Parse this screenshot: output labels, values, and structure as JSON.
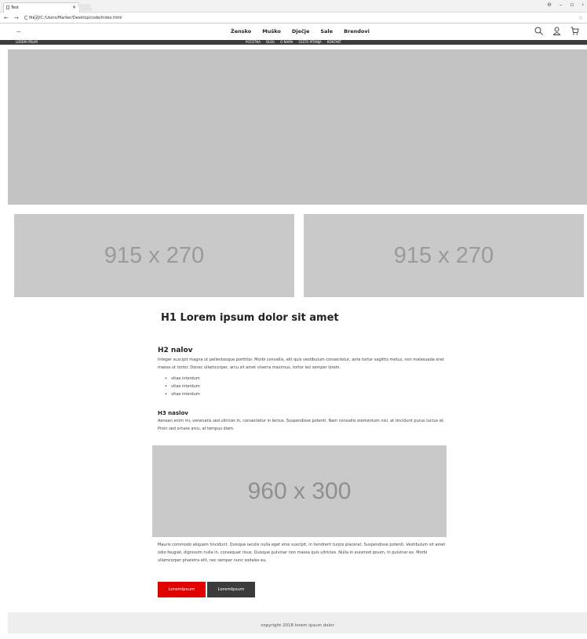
{
  "browser": {
    "tab_title": "Test",
    "tab_close": "×",
    "url": "file:///C:/Users/Marker/Desktop/code/index.html",
    "nav": {
      "back": "←",
      "forward": "→",
      "reload": "C",
      "info": "ⓘ"
    },
    "star": "☆",
    "window_controls": {
      "account": "⊖",
      "minimize": "–",
      "maximize": "▫",
      "close": "›"
    }
  },
  "header": {
    "logo": "----",
    "nav": [
      "Žensko",
      "Muško",
      "Dječje",
      "Sale",
      "Brendovi"
    ],
    "icons": [
      "search-icon",
      "user-icon",
      "cart-icon"
    ]
  },
  "topbar": {
    "left": "LOREM IPSUM",
    "links": [
      "POČETNA",
      "BLOG",
      "O NAMA",
      "ČESTA PITANJA",
      "KONTAKT"
    ]
  },
  "promos": [
    "915 x 270",
    "915 x 270"
  ],
  "article": {
    "h1": "H1 Lorem ipsum dolor sit amet",
    "h2": "H2 nalov",
    "p1": "Integer suscipit magna ut pellentesque porttitor. Morbi convallis, elit quis vestibulum consectetur, ante tortor sagittis metus, non malesuada erat massa ut tortor. Donec ullamcorper, arcu sit amet viverra maximus, tortor leo semper lorem.",
    "list": [
      "vitae interdum",
      "vitae interdum",
      "vitae interdum"
    ],
    "h3": "H3 naslov",
    "p2": "Aenean enim mi, venenatis sed ultrices in, consectetur in lectus. Suspendisse potenti. Nam convallis elementum nisi, at tincidunt purus luctus et. Proin sed ornare arcu, at tempus diam.",
    "big_image": "960 x 300",
    "p3": "Mauris commodo aliquam tincidunt. Quisque iaculis nulla eget eros suscipit, in hendrerit turpis placerat. Suspendisse potenti. Vestibulum sit amet odio feugiat, dignissim nulla in, consequat risus. Quisque pulvinar non massa quis ultricies. Nulla in euismod ipsum, in pulvinar ex. Morbi ullamcorper pharetra elit, nec semper nunc sodales eu.",
    "buttons": [
      "LoremIpsum",
      "LoremIpsum"
    ]
  },
  "footer": "copyright 2018 lorem ipsum dolor"
}
